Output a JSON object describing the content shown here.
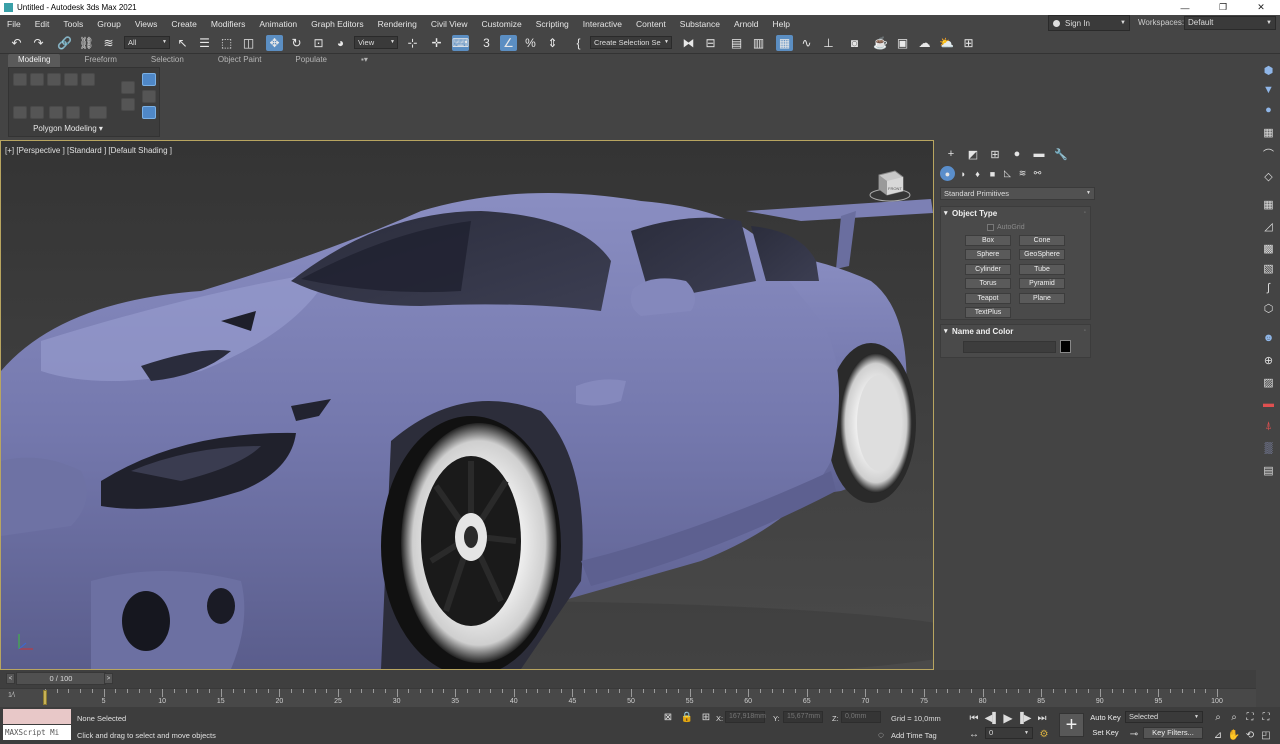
{
  "window": {
    "title": "Untitled - Autodesk 3ds Max 2021",
    "controls": [
      "—",
      "❐",
      "✕"
    ]
  },
  "menu": [
    "File",
    "Edit",
    "Tools",
    "Group",
    "Views",
    "Create",
    "Modifiers",
    "Animation",
    "Graph Editors",
    "Rendering",
    "Civil View",
    "Customize",
    "Scripting",
    "Interactive",
    "Content",
    "Substance",
    "Arnold",
    "Help"
  ],
  "account": {
    "sign_in": "Sign In",
    "workspaces_label": "Workspaces:",
    "workspace": "Default"
  },
  "toolbar": {
    "filter": "All",
    "ref_coord": "View",
    "selection_set_placeholder": "Create Selection Se"
  },
  "ribbon": {
    "tabs": [
      "Modeling",
      "Freeform",
      "Selection",
      "Object Paint",
      "Populate"
    ],
    "active_tab": "Modeling",
    "panel_label": "Polygon Modeling"
  },
  "viewport": {
    "label": "[+] [Perspective ] [Standard ] [Default Shading ]",
    "cube_face": "FRONT",
    "body_color": "#7b7fb3"
  },
  "command_panel": {
    "category": "Standard Primitives",
    "object_type": {
      "title": "Object Type",
      "autogrid": "AutoGrid",
      "buttons": [
        "Box",
        "Cone",
        "Sphere",
        "GeoSphere",
        "Cylinder",
        "Tube",
        "Torus",
        "Pyramid",
        "Teapot",
        "Plane",
        "TextPlus"
      ]
    },
    "name_color": {
      "title": "Name and Color",
      "swatch": "#000000"
    }
  },
  "timeline": {
    "slider": "0 / 100",
    "current_frame": 0,
    "ticks": [
      0,
      5,
      10,
      15,
      20,
      25,
      30,
      35,
      40,
      45,
      50,
      55,
      60,
      65,
      70,
      75,
      80,
      85,
      90,
      95,
      100
    ]
  },
  "status": {
    "maxscript": "MAXScript Mi",
    "selection": "None Selected",
    "prompt": "Click and drag to select and move objects",
    "x_label": "X:",
    "x": "167,918mm",
    "y_label": "Y:",
    "y": "15,677mm",
    "z_label": "Z:",
    "z": "0,0mm",
    "grid": "Grid = 10,0mm",
    "add_time_tag": "Add Time Tag",
    "auto_key": "Auto Key",
    "set_key": "Set Key",
    "key_mode": "Selected",
    "key_filters": "Key Filters...",
    "frame_field": "0"
  }
}
